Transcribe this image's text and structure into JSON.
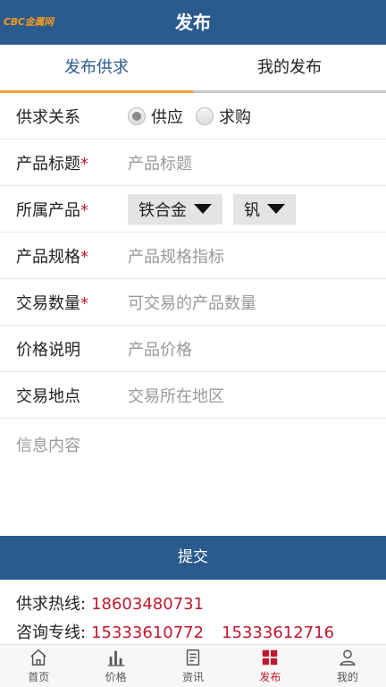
{
  "header": {
    "logo": "CBC金属网",
    "title": "发布"
  },
  "tabs": [
    {
      "label": "发布供求",
      "active": true
    },
    {
      "label": "我的发布",
      "active": false
    }
  ],
  "form": {
    "relation": {
      "label": "供求关系",
      "options": [
        {
          "label": "供应",
          "checked": true
        },
        {
          "label": "求购",
          "checked": false
        }
      ]
    },
    "title_field": {
      "label": "产品标题",
      "placeholder": "产品标题"
    },
    "product": {
      "label": "所属产品",
      "select1": "铁合金",
      "select2": "钒"
    },
    "spec": {
      "label": "产品规格",
      "placeholder": "产品规格指标"
    },
    "quantity": {
      "label": "交易数量",
      "placeholder": "可交易的产品数量"
    },
    "price": {
      "label": "价格说明",
      "placeholder": "产品价格"
    },
    "location": {
      "label": "交易地点",
      "placeholder": "交易所在地区"
    },
    "content": {
      "placeholder": "信息内容"
    },
    "required_mark": "*"
  },
  "submit_label": "提交",
  "contacts": {
    "hotline_label": "供求热线:",
    "hotline": "18603480731",
    "consult_label": "咨询专线:",
    "consult1": "15333610772",
    "consult2": "15333612716"
  },
  "nav": [
    {
      "label": "首页",
      "icon": "home-icon"
    },
    {
      "label": "价格",
      "icon": "bar-chart-icon"
    },
    {
      "label": "资讯",
      "icon": "news-icon"
    },
    {
      "label": "发布",
      "icon": "grid-icon",
      "active": true
    },
    {
      "label": "我的",
      "icon": "user-icon"
    }
  ],
  "colors": {
    "primary": "#2a5a8e",
    "accent": "#f0a33a",
    "red": "#c0182f"
  }
}
